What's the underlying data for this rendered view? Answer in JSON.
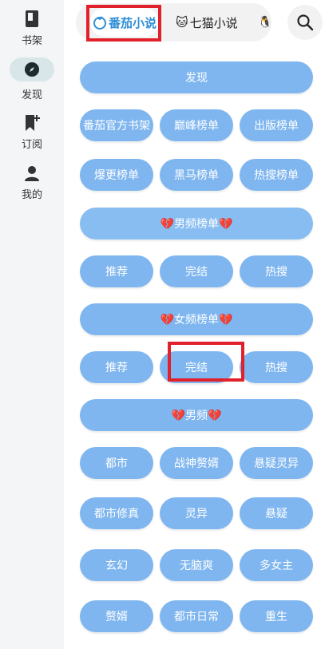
{
  "sidebar": {
    "items": [
      {
        "label": "书架",
        "icon": "book-icon"
      },
      {
        "label": "发现",
        "icon": "compass-icon"
      },
      {
        "label": "订阅",
        "icon": "bookmark-add-icon"
      },
      {
        "label": "我的",
        "icon": "person-icon"
      }
    ]
  },
  "tabs": [
    {
      "label": "番茄小说",
      "icon": "tomato-icon",
      "active": true
    },
    {
      "label": "七猫小说",
      "icon": "cat-icon",
      "active": false
    },
    {
      "label": "",
      "icon": "penguin-icon",
      "active": false
    }
  ],
  "search": {
    "icon": "search-icon"
  },
  "sections": {
    "discover": "发现",
    "top_row": [
      "番茄官方书架",
      "巅峰榜单",
      "出版榜单"
    ],
    "second_row": [
      "爆更榜单",
      "黑马榜单",
      "热搜榜单"
    ],
    "male_rank_header": "💔男频榜单💔",
    "male_rank": [
      "推荐",
      "完结",
      "热搜"
    ],
    "female_rank_header": "💔女频榜单💔",
    "female_rank": [
      "推荐",
      "完结",
      "热搜"
    ],
    "male_header": "💔男频💔",
    "male_genres_1": [
      "都市",
      "战神赘婿",
      "悬疑灵异"
    ],
    "male_genres_2": [
      "都市修真",
      "灵异",
      "悬疑"
    ],
    "male_genres_3": [
      "玄幻",
      "无脑爽",
      "多女主"
    ],
    "male_genres_4": [
      "赘婿",
      "都市日常",
      "重生"
    ]
  },
  "colors": {
    "pill": "#7fb6ef",
    "accent": "#2f8ed6",
    "highlight": "#e0202a"
  }
}
